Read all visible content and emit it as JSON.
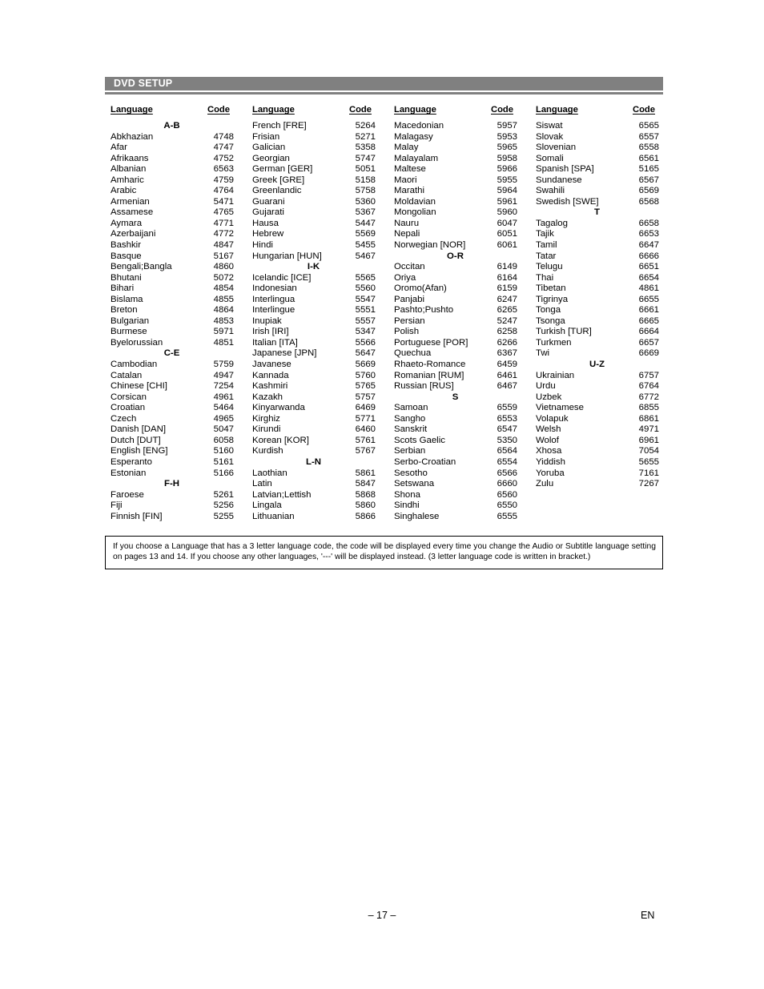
{
  "header": {
    "section_title": "DVD SETUP"
  },
  "table": {
    "headers": [
      "Language",
      "Code",
      "Language",
      "Code",
      "Language",
      "Code",
      "Language",
      "Code"
    ],
    "columns": [
      {
        "rows": [
          {
            "type": "group",
            "label": "A-B"
          },
          {
            "type": "item",
            "language": "Abkhazian",
            "code": "4748"
          },
          {
            "type": "item",
            "language": "Afar",
            "code": "4747"
          },
          {
            "type": "item",
            "language": "Afrikaans",
            "code": "4752"
          },
          {
            "type": "item",
            "language": "Albanian",
            "code": "6563"
          },
          {
            "type": "item",
            "language": "Amharic",
            "code": "4759"
          },
          {
            "type": "item",
            "language": "Arabic",
            "code": "4764"
          },
          {
            "type": "item",
            "language": "Armenian",
            "code": "5471"
          },
          {
            "type": "item",
            "language": "Assamese",
            "code": "4765"
          },
          {
            "type": "item",
            "language": "Aymara",
            "code": "4771"
          },
          {
            "type": "item",
            "language": "Azerbaijani",
            "code": "4772"
          },
          {
            "type": "item",
            "language": "Bashkir",
            "code": "4847"
          },
          {
            "type": "item",
            "language": "Basque",
            "code": "5167"
          },
          {
            "type": "item",
            "language": "Bengali;Bangla",
            "code": "4860"
          },
          {
            "type": "item",
            "language": "Bhutani",
            "code": "5072"
          },
          {
            "type": "item",
            "language": "Bihari",
            "code": "4854"
          },
          {
            "type": "item",
            "language": "Bislama",
            "code": "4855"
          },
          {
            "type": "item",
            "language": "Breton",
            "code": "4864"
          },
          {
            "type": "item",
            "language": "Bulgarian",
            "code": "4853"
          },
          {
            "type": "item",
            "language": "Burmese",
            "code": "5971"
          },
          {
            "type": "item",
            "language": "Byelorussian",
            "code": "4851"
          },
          {
            "type": "group",
            "label": "C-E"
          },
          {
            "type": "item",
            "language": "Cambodian",
            "code": "5759"
          },
          {
            "type": "item",
            "language": "Catalan",
            "code": "4947"
          },
          {
            "type": "item",
            "language": "Chinese [CHI]",
            "code": "7254"
          },
          {
            "type": "item",
            "language": "Corsican",
            "code": "4961"
          },
          {
            "type": "item",
            "language": "Croatian",
            "code": "5464"
          },
          {
            "type": "item",
            "language": "Czech",
            "code": "4965"
          },
          {
            "type": "item",
            "language": "Danish [DAN]",
            "code": "5047"
          },
          {
            "type": "item",
            "language": "Dutch [DUT]",
            "code": "6058"
          },
          {
            "type": "item",
            "language": "English [ENG]",
            "code": "5160"
          },
          {
            "type": "item",
            "language": "Esperanto",
            "code": "5161"
          },
          {
            "type": "item",
            "language": "Estonian",
            "code": "5166"
          },
          {
            "type": "group",
            "label": "F-H"
          },
          {
            "type": "item",
            "language": "Faroese",
            "code": "5261"
          },
          {
            "type": "item",
            "language": "Fiji",
            "code": "5256"
          },
          {
            "type": "item",
            "language": "Finnish [FIN]",
            "code": "5255"
          }
        ]
      },
      {
        "rows": [
          {
            "type": "item",
            "language": "French [FRE]",
            "code": "5264"
          },
          {
            "type": "item",
            "language": "Frisian",
            "code": "5271"
          },
          {
            "type": "item",
            "language": "Galician",
            "code": "5358"
          },
          {
            "type": "item",
            "language": "Georgian",
            "code": "5747"
          },
          {
            "type": "item",
            "language": "German [GER]",
            "code": "5051"
          },
          {
            "type": "item",
            "language": "Greek [GRE]",
            "code": "5158"
          },
          {
            "type": "item",
            "language": "Greenlandic",
            "code": "5758"
          },
          {
            "type": "item",
            "language": "Guarani",
            "code": "5360"
          },
          {
            "type": "item",
            "language": "Gujarati",
            "code": "5367"
          },
          {
            "type": "item",
            "language": "Hausa",
            "code": "5447"
          },
          {
            "type": "item",
            "language": "Hebrew",
            "code": "5569"
          },
          {
            "type": "item",
            "language": "Hindi",
            "code": "5455"
          },
          {
            "type": "item",
            "language": "Hungarian [HUN]",
            "code": "5467"
          },
          {
            "type": "group",
            "label": "I-K"
          },
          {
            "type": "item",
            "language": "Icelandic [ICE]",
            "code": "5565"
          },
          {
            "type": "item",
            "language": "Indonesian",
            "code": "5560"
          },
          {
            "type": "item",
            "language": "Interlingua",
            "code": "5547"
          },
          {
            "type": "item",
            "language": "Interlingue",
            "code": "5551"
          },
          {
            "type": "item",
            "language": "Inupiak",
            "code": "5557"
          },
          {
            "type": "item",
            "language": "Irish [IRI]",
            "code": "5347"
          },
          {
            "type": "item",
            "language": "Italian [ITA]",
            "code": "5566"
          },
          {
            "type": "item",
            "language": "Japanese [JPN]",
            "code": "5647"
          },
          {
            "type": "item",
            "language": "Javanese",
            "code": "5669"
          },
          {
            "type": "item",
            "language": "Kannada",
            "code": "5760"
          },
          {
            "type": "item",
            "language": "Kashmiri",
            "code": "5765"
          },
          {
            "type": "item",
            "language": "Kazakh",
            "code": "5757"
          },
          {
            "type": "item",
            "language": "Kinyarwanda",
            "code": "6469"
          },
          {
            "type": "item",
            "language": "Kirghiz",
            "code": "5771"
          },
          {
            "type": "item",
            "language": "Kirundi",
            "code": "6460"
          },
          {
            "type": "item",
            "language": "Korean [KOR]",
            "code": "5761"
          },
          {
            "type": "item",
            "language": "Kurdish",
            "code": "5767"
          },
          {
            "type": "group",
            "label": "L-N"
          },
          {
            "type": "item",
            "language": "Laothian",
            "code": "5861"
          },
          {
            "type": "item",
            "language": "Latin",
            "code": "5847"
          },
          {
            "type": "item",
            "language": "Latvian;Lettish",
            "code": "5868"
          },
          {
            "type": "item",
            "language": "Lingala",
            "code": "5860"
          },
          {
            "type": "item",
            "language": "Lithuanian",
            "code": "5866"
          }
        ]
      },
      {
        "rows": [
          {
            "type": "item",
            "language": "Macedonian",
            "code": "5957"
          },
          {
            "type": "item",
            "language": "Malagasy",
            "code": "5953"
          },
          {
            "type": "item",
            "language": "Malay",
            "code": "5965"
          },
          {
            "type": "item",
            "language": "Malayalam",
            "code": "5958"
          },
          {
            "type": "item",
            "language": "Maltese",
            "code": "5966"
          },
          {
            "type": "item",
            "language": "Maori",
            "code": "5955"
          },
          {
            "type": "item",
            "language": "Marathi",
            "code": "5964"
          },
          {
            "type": "item",
            "language": "Moldavian",
            "code": "5961"
          },
          {
            "type": "item",
            "language": "Mongolian",
            "code": "5960"
          },
          {
            "type": "item",
            "language": "Nauru",
            "code": "6047"
          },
          {
            "type": "item",
            "language": "Nepali",
            "code": "6051"
          },
          {
            "type": "item",
            "language": "Norwegian [NOR]",
            "code": "6061"
          },
          {
            "type": "group",
            "label": "O-R"
          },
          {
            "type": "item",
            "language": "Occitan",
            "code": "6149"
          },
          {
            "type": "item",
            "language": "Oriya",
            "code": "6164"
          },
          {
            "type": "item",
            "language": "Oromo(Afan)",
            "code": "6159"
          },
          {
            "type": "item",
            "language": "Panjabi",
            "code": "6247"
          },
          {
            "type": "item",
            "language": "Pashto;Pushto",
            "code": "6265"
          },
          {
            "type": "item",
            "language": "Persian",
            "code": "5247"
          },
          {
            "type": "item",
            "language": "Polish",
            "code": "6258"
          },
          {
            "type": "item",
            "language": "Portuguese [POR]",
            "code": "6266"
          },
          {
            "type": "item",
            "language": "Quechua",
            "code": "6367"
          },
          {
            "type": "item",
            "language": "Rhaeto-Romance",
            "code": "6459"
          },
          {
            "type": "item",
            "language": "Romanian [RUM]",
            "code": "6461"
          },
          {
            "type": "item",
            "language": "Russian [RUS]",
            "code": "6467"
          },
          {
            "type": "group",
            "label": "S"
          },
          {
            "type": "item",
            "language": "Samoan",
            "code": "6559"
          },
          {
            "type": "item",
            "language": "Sangho",
            "code": "6553"
          },
          {
            "type": "item",
            "language": "Sanskrit",
            "code": "6547"
          },
          {
            "type": "item",
            "language": "Scots Gaelic",
            "code": "5350"
          },
          {
            "type": "item",
            "language": "Serbian",
            "code": "6564"
          },
          {
            "type": "item",
            "language": "Serbo-Croatian",
            "code": "6554"
          },
          {
            "type": "item",
            "language": "Sesotho",
            "code": "6566"
          },
          {
            "type": "item",
            "language": "Setswana",
            "code": "6660"
          },
          {
            "type": "item",
            "language": "Shona",
            "code": "6560"
          },
          {
            "type": "item",
            "language": "Sindhi",
            "code": "6550"
          },
          {
            "type": "item",
            "language": "Singhalese",
            "code": "6555"
          }
        ]
      },
      {
        "rows": [
          {
            "type": "item",
            "language": "Siswat",
            "code": "6565"
          },
          {
            "type": "item",
            "language": "Slovak",
            "code": "6557"
          },
          {
            "type": "item",
            "language": "Slovenian",
            "code": "6558"
          },
          {
            "type": "item",
            "language": "Somali",
            "code": "6561"
          },
          {
            "type": "item",
            "language": "Spanish [SPA]",
            "code": "5165"
          },
          {
            "type": "item",
            "language": "Sundanese",
            "code": "6567"
          },
          {
            "type": "item",
            "language": "Swahili",
            "code": "6569"
          },
          {
            "type": "item",
            "language": "Swedish [SWE]",
            "code": "6568"
          },
          {
            "type": "group",
            "label": "T"
          },
          {
            "type": "item",
            "language": "Tagalog",
            "code": "6658"
          },
          {
            "type": "item",
            "language": "Tajik",
            "code": "6653"
          },
          {
            "type": "item",
            "language": "Tamil",
            "code": "6647"
          },
          {
            "type": "item",
            "language": "Tatar",
            "code": "6666"
          },
          {
            "type": "item",
            "language": "Telugu",
            "code": "6651"
          },
          {
            "type": "item",
            "language": "Thai",
            "code": "6654"
          },
          {
            "type": "item",
            "language": "Tibetan",
            "code": "4861"
          },
          {
            "type": "item",
            "language": "Tigrinya",
            "code": "6655"
          },
          {
            "type": "item",
            "language": "Tonga",
            "code": "6661"
          },
          {
            "type": "item",
            "language": "Tsonga",
            "code": "6665"
          },
          {
            "type": "item",
            "language": "Turkish [TUR]",
            "code": "6664"
          },
          {
            "type": "item",
            "language": "Turkmen",
            "code": "6657"
          },
          {
            "type": "item",
            "language": "Twi",
            "code": "6669"
          },
          {
            "type": "group",
            "label": "U-Z"
          },
          {
            "type": "item",
            "language": "Ukrainian",
            "code": "6757"
          },
          {
            "type": "item",
            "language": "Urdu",
            "code": "6764"
          },
          {
            "type": "item",
            "language": "Uzbek",
            "code": "6772"
          },
          {
            "type": "item",
            "language": "Vietnamese",
            "code": "6855"
          },
          {
            "type": "item",
            "language": "Volapuk",
            "code": "6861"
          },
          {
            "type": "item",
            "language": "Welsh",
            "code": "4971"
          },
          {
            "type": "item",
            "language": "Wolof",
            "code": "6961"
          },
          {
            "type": "item",
            "language": "Xhosa",
            "code": "7054"
          },
          {
            "type": "item",
            "language": "Yiddish",
            "code": "5655"
          },
          {
            "type": "item",
            "language": "Yoruba",
            "code": "7161"
          },
          {
            "type": "item",
            "language": "Zulu",
            "code": "7267"
          }
        ]
      }
    ]
  },
  "note": {
    "text": "If you choose a Language that has a 3 letter language code, the code will be displayed every time you change the Audio or Subtitle language setting on pages 13 and 14. If you choose any other languages, '---' will be displayed instead. (3 letter language code is written in bracket.)"
  },
  "footer": {
    "page_number": "– 17 –",
    "language_mark": "EN"
  },
  "colors": {
    "header_bar": "#808080",
    "header_text": "#ffffff",
    "body_text": "#000000",
    "page_background": "#ffffff"
  }
}
